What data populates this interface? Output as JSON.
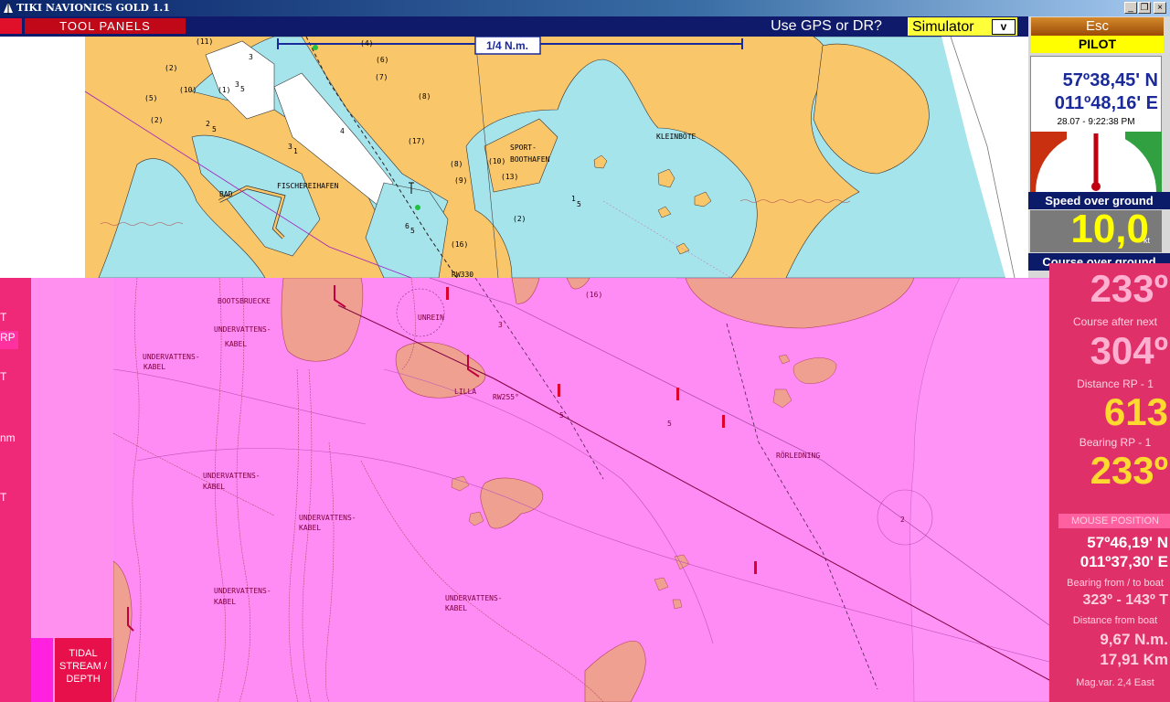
{
  "window": {
    "title": "TIKI NAVIONICS GOLD 1.1",
    "min": "_",
    "max": "❐",
    "close": "×"
  },
  "toolbar": {
    "tool_panels": "TOOL PANELS",
    "gps_question": "Use GPS or DR?",
    "simulator": "Simulator",
    "sim_value": "v"
  },
  "nav": {
    "esc": "Esc",
    "mode": "PILOT",
    "lat": "57º38,45' N",
    "lon": "011º48,16' E",
    "datetime": "28.07 - 9:22:38 PM",
    "sog_label": "Speed over ground",
    "sog_value": "10,0",
    "sog_unit": "kt",
    "cog_label": "Course over ground"
  },
  "chart_top": {
    "scale": "1/4 N.m.",
    "labels": [
      "FISCHEREIHAFEN",
      "BAD",
      "SPORT-",
      "BOOTHAFEN",
      "KLEINBÖTE"
    ],
    "depths": [
      "(11)",
      "3",
      "(2)",
      "(10)",
      "(1)",
      "3",
      "5",
      "(5)",
      "(2)",
      "2",
      "5",
      "3",
      "1",
      "4",
      "(6)",
      "(7)",
      "(8)",
      "(17)",
      "(8)",
      "(9)",
      "(10)",
      "(13)",
      "(2)",
      "1",
      "5",
      "6",
      "5",
      "(16)",
      "(4)",
      "RW330"
    ]
  },
  "chart_bottom": {
    "labels": [
      "BOOTSBRUECKE",
      "UNDERVATTENS-",
      "KABEL",
      "UNDERVATTENS-",
      "KABEL",
      "UNREIN",
      "LILLA",
      "RW255°",
      "RÖRLEDNING",
      "UNDERVATTENS-",
      "KABEL",
      "UNDERVATTENS-",
      "KABEL",
      "UNDERVATTENS-",
      "KABEL",
      "UNDERVATTENS-",
      "KABEL"
    ],
    "depths": [
      "(16)",
      "3",
      "5",
      "2",
      "5"
    ]
  },
  "panel_right": {
    "cog_value": "233º",
    "course_next_label": "Course after next",
    "course_next_value": "304º",
    "dist_label": "Distance RP - 1",
    "dist_value": "613",
    "bearing_label": "Bearing RP - 1",
    "bearing_value": "233º",
    "mouse_label": "MOUSE POSITION",
    "mouse_lat": "57º46,19' N",
    "mouse_lon": "011º37,30' E",
    "bft_label": "Bearing from / to boat",
    "bft_value": "323º - 143º T",
    "dfb_label": "Distance from boat",
    "dfb_nm": "9,67 N.m.",
    "dfb_km": "17,91 Km",
    "magvar": "Mag.var.  2,4  East"
  },
  "panel_left": {
    "side_labels": [
      "T",
      "RP",
      "T",
      "nm",
      "T"
    ],
    "tidal": "TIDAL STREAM / DEPTH"
  }
}
